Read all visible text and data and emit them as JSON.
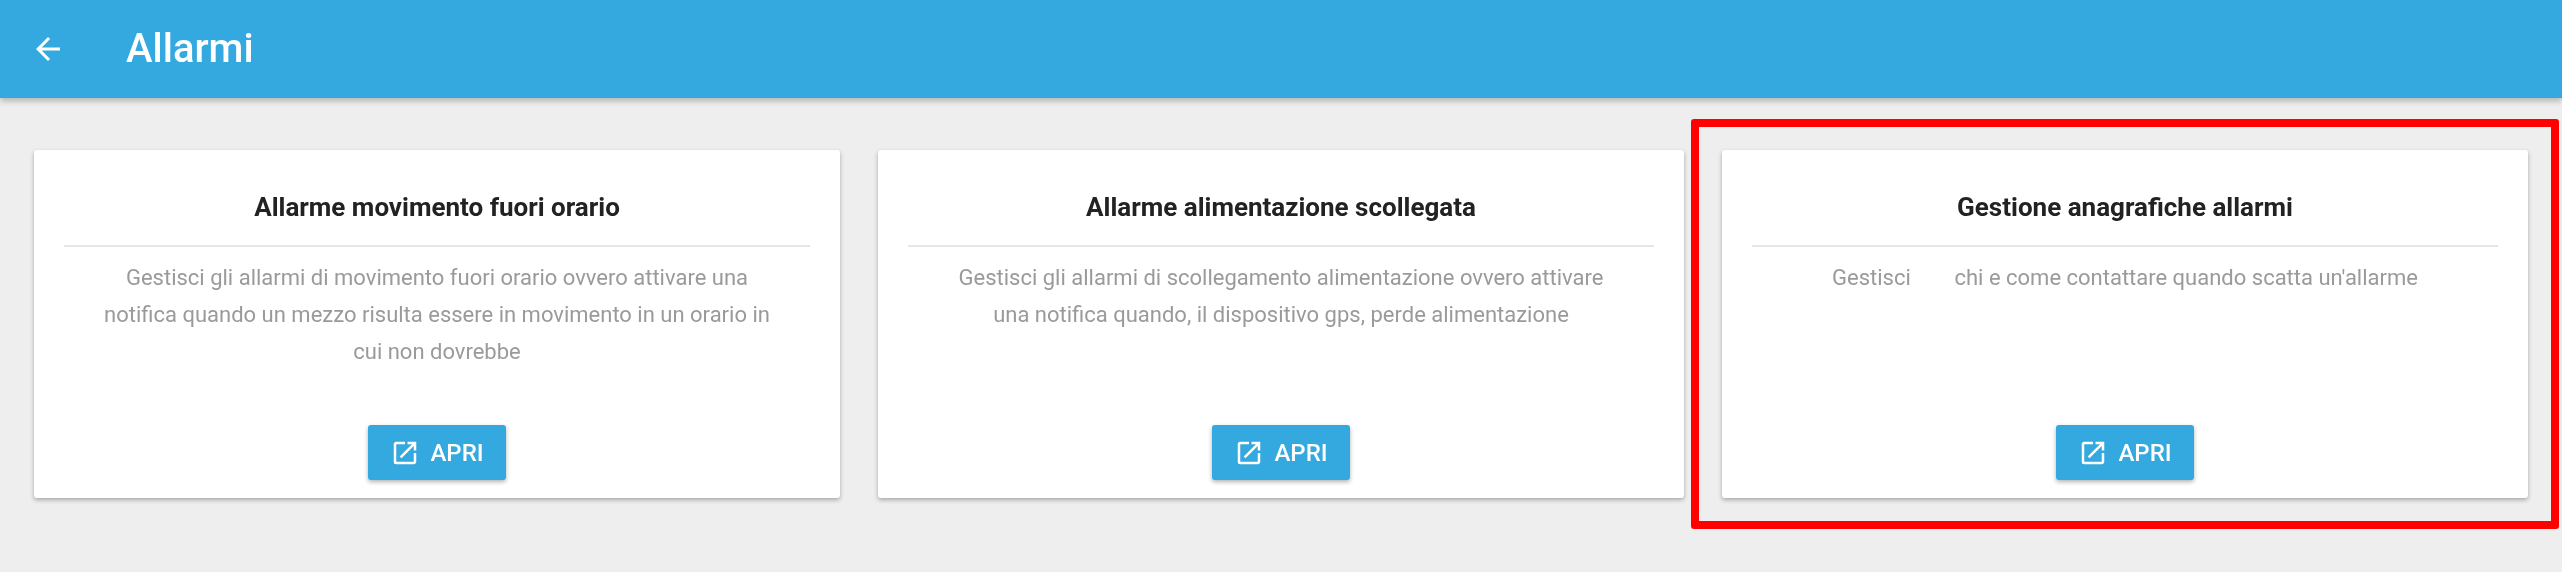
{
  "header": {
    "title": "Allarmi"
  },
  "cards": [
    {
      "title": "Allarme movimento fuori orario",
      "description": "Gestisci gli allarmi di movimento fuori orario ovvero attivare una notifica quando un mezzo risulta essere in movimento in un orario in cui non dovrebbe",
      "button": "APRI",
      "highlighted": false
    },
    {
      "title": "Allarme alimentazione scollegata",
      "description": "Gestisci gli allarmi di scollegamento alimentazione ovvero attivare una notifica quando, il dispositivo gps, perde alimentazione",
      "button": "APRI",
      "highlighted": false
    },
    {
      "title": "Gestione anagrafiche allarmi",
      "description": "Gestisci        chi e come contattare quando scatta un'allarme",
      "button": "APRI",
      "highlighted": true
    }
  ]
}
